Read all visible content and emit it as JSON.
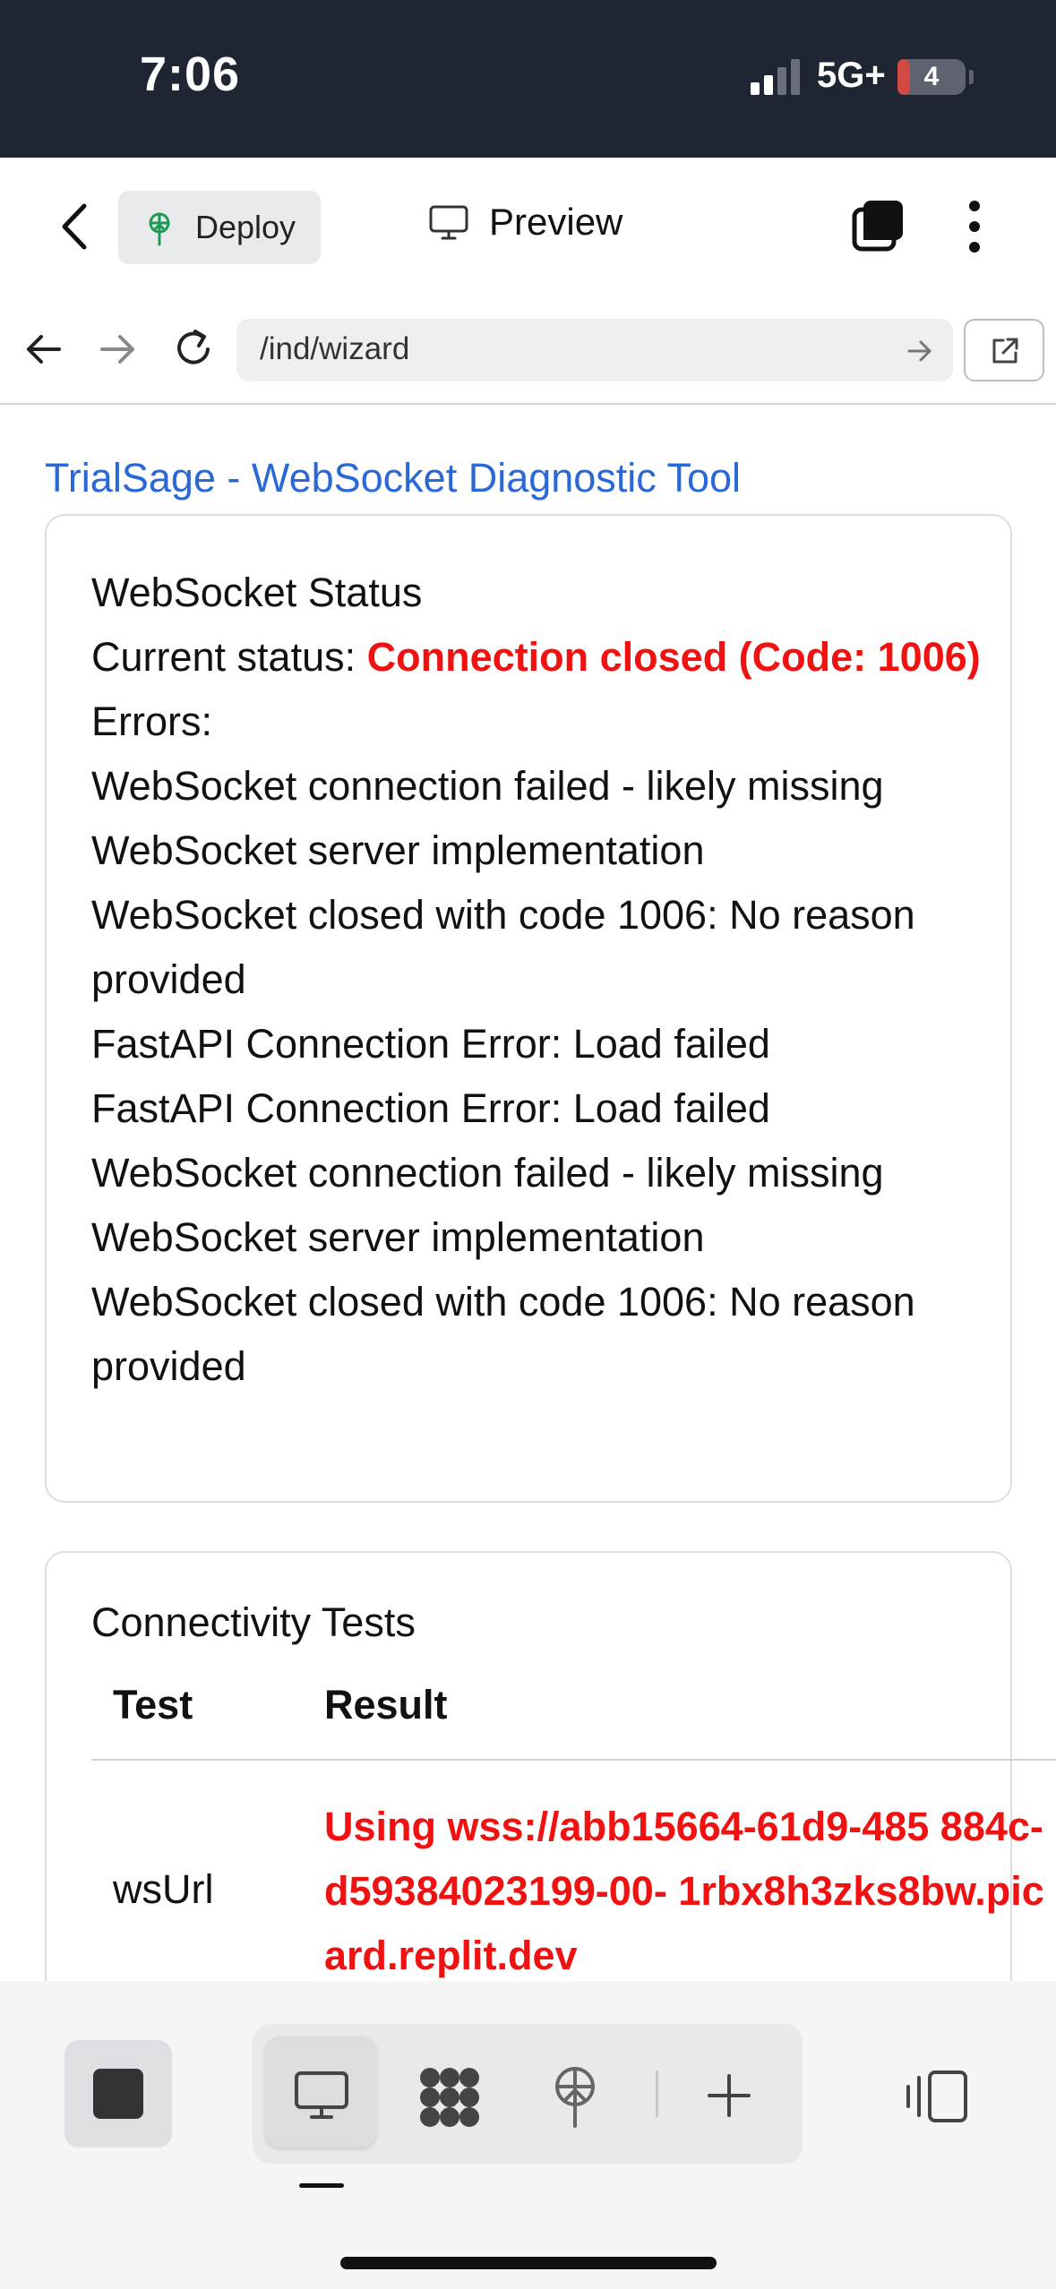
{
  "status_bar": {
    "time": "7:06",
    "network": "5G+",
    "battery_level": "4"
  },
  "app_header": {
    "deploy_label": "Deploy",
    "preview_label": "Preview"
  },
  "browser": {
    "url": "/ind/wizard"
  },
  "page": {
    "title": "TrialSage - WebSocket Diagnostic Tool",
    "status_card": {
      "heading": "WebSocket Status",
      "current_status_label": "Current status:",
      "current_status_value": "Connection closed (Code: 1006)",
      "errors_label": "Errors:",
      "errors": [
        "WebSocket connection failed - likely missing WebSocket server implementation",
        "WebSocket closed with code 1006: No reason provided",
        "FastAPI Connection Error: Load failed",
        "FastAPI Connection Error: Load failed",
        "WebSocket connection failed - likely missing WebSocket server implementation",
        "WebSocket closed with code 1006: No reason provided"
      ]
    },
    "connectivity": {
      "heading": "Connectivity Tests",
      "col_test": "Test",
      "col_result": "Result",
      "rows": [
        {
          "test": "wsUrl",
          "result": "Using wss://abb15664-61d9-485 884c-d59384023199-00- 1rbx8h3zks8bw.picard.replit.dev"
        }
      ]
    }
  },
  "colors": {
    "status_bar_bg": "#1f2533",
    "title_blue": "#2a68d6",
    "error_red": "#f01111"
  }
}
